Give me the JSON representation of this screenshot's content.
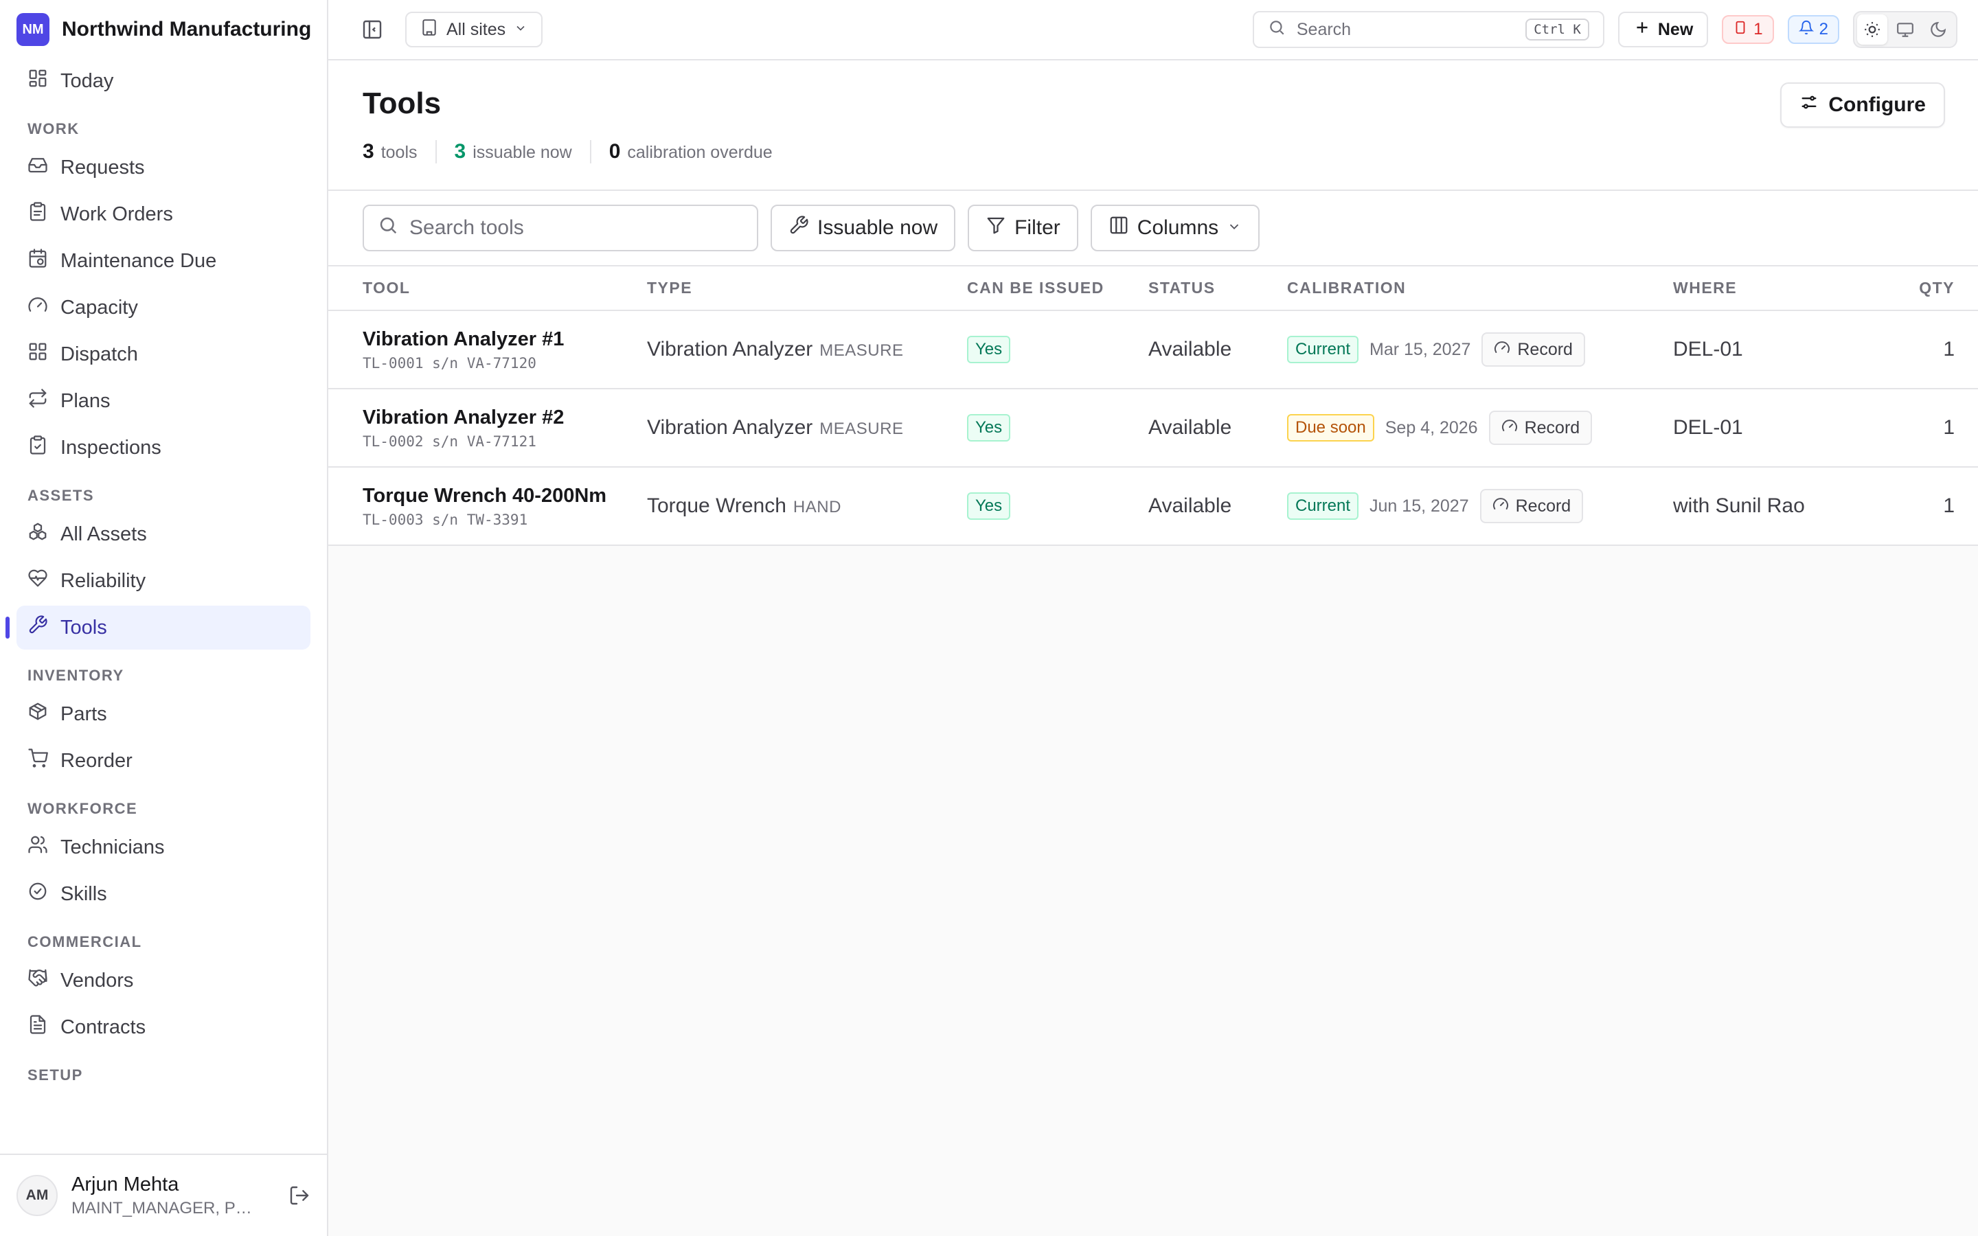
{
  "brand": {
    "logo_text": "NM",
    "name": "Northwind Manufacturing",
    "accent": "#4f46e5"
  },
  "sidebar": {
    "top_item": {
      "label": "Today",
      "icon": "dashboard-icon"
    },
    "sections": [
      {
        "title": "WORK",
        "items": [
          {
            "label": "Requests",
            "icon": "inbox-icon"
          },
          {
            "label": "Work Orders",
            "icon": "clipboard-icon"
          },
          {
            "label": "Maintenance Due",
            "icon": "calendar-clock-icon"
          },
          {
            "label": "Capacity",
            "icon": "gauge-icon"
          },
          {
            "label": "Dispatch",
            "icon": "grid-icon"
          },
          {
            "label": "Plans",
            "icon": "repeat-icon"
          },
          {
            "label": "Inspections",
            "icon": "clipboard-check-icon"
          }
        ]
      },
      {
        "title": "ASSETS",
        "items": [
          {
            "label": "All Assets",
            "icon": "boxes-icon"
          },
          {
            "label": "Reliability",
            "icon": "heart-pulse-icon"
          },
          {
            "label": "Tools",
            "icon": "wrench-icon",
            "active": true
          }
        ]
      },
      {
        "title": "INVENTORY",
        "items": [
          {
            "label": "Parts",
            "icon": "package-icon"
          },
          {
            "label": "Reorder",
            "icon": "cart-icon"
          }
        ]
      },
      {
        "title": "WORKFORCE",
        "items": [
          {
            "label": "Technicians",
            "icon": "users-icon"
          },
          {
            "label": "Skills",
            "icon": "badge-check-icon"
          }
        ]
      },
      {
        "title": "COMMERCIAL",
        "items": [
          {
            "label": "Vendors",
            "icon": "handshake-icon"
          },
          {
            "label": "Contracts",
            "icon": "file-icon"
          }
        ]
      },
      {
        "title": "SETUP",
        "items": []
      }
    ],
    "user": {
      "initials": "AM",
      "name": "Arjun Mehta",
      "role": "MAINT_MANAGER, PL..."
    }
  },
  "topbar": {
    "site_select": "All sites",
    "search_placeholder": "Search",
    "search_shortcut": "Ctrl K",
    "new_label": "New",
    "alerts_count": "1",
    "notifications_count": "2"
  },
  "page": {
    "title": "Tools",
    "configure_label": "Configure",
    "stats": [
      {
        "value": "3",
        "label": "tools"
      },
      {
        "value": "3",
        "label": "issuable now"
      },
      {
        "value": "0",
        "label": "calibration overdue"
      }
    ]
  },
  "toolbar": {
    "search_placeholder": "Search tools",
    "issuable_label": "Issuable now",
    "filter_label": "Filter",
    "columns_label": "Columns"
  },
  "table": {
    "headers": [
      "TOOL",
      "TYPE",
      "CAN BE ISSUED",
      "STATUS",
      "CALIBRATION",
      "WHERE",
      "QTY"
    ],
    "rows": [
      {
        "name": "Vibration Analyzer #1",
        "sub": "TL-0001 s/n VA-77120",
        "type": "Vibration Analyzer",
        "type_tag": "MEASURE",
        "issuable": "Yes",
        "status": "Available",
        "cal_status": "Current",
        "cal_tone": "green",
        "cal_date": "Mar 15, 2027",
        "record_label": "Record",
        "where": "DEL-01",
        "qty": "1"
      },
      {
        "name": "Vibration Analyzer #2",
        "sub": "TL-0002 s/n VA-77121",
        "type": "Vibration Analyzer",
        "type_tag": "MEASURE",
        "issuable": "Yes",
        "status": "Available",
        "cal_status": "Due soon",
        "cal_tone": "amber",
        "cal_date": "Sep 4, 2026",
        "record_label": "Record",
        "where": "DEL-01",
        "qty": "1"
      },
      {
        "name": "Torque Wrench 40-200Nm",
        "sub": "TL-0003 s/n TW-3391",
        "type": "Torque Wrench",
        "type_tag": "HAND",
        "issuable": "Yes",
        "status": "Available",
        "cal_status": "Current",
        "cal_tone": "green",
        "cal_date": "Jun 15, 2027",
        "record_label": "Record",
        "where": "with Sunil Rao",
        "qty": "1"
      }
    ]
  }
}
